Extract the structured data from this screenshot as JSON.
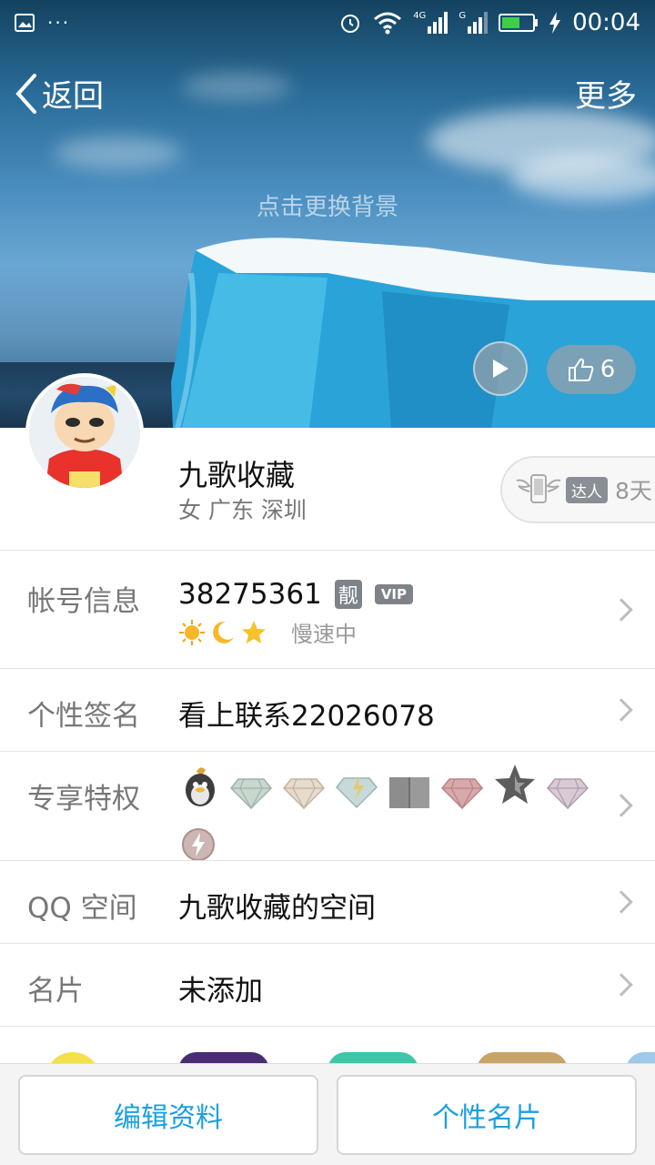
{
  "status_bar": {
    "time": "00:04",
    "network_1": "4G",
    "network_2": "G"
  },
  "nav": {
    "back_label": "返回",
    "more_label": "更多"
  },
  "hero": {
    "change_background": "点击更换背景",
    "like_count": "6"
  },
  "profile": {
    "nickname": "九歌收藏",
    "location": "女 广东 深圳",
    "talent_badge": "达人",
    "talent_days": "8天"
  },
  "rows": {
    "account": {
      "label": "帐号信息",
      "qq_number": "38275361",
      "liang_badge": "靓",
      "vip_badge": "VIP",
      "speed_status": "慢速中"
    },
    "signature": {
      "label": "个性签名",
      "value": "看上联系22026078"
    },
    "privileges": {
      "label": "专享特权"
    },
    "qzone": {
      "label": "QQ 空间",
      "value": "九歌收藏的空间"
    },
    "card": {
      "label": "名片",
      "value": "未添加"
    }
  },
  "bottom_bar": {
    "edit_profile": "编辑资料",
    "personal_card": "个性名片"
  },
  "colors": {
    "accent": "#1aa0e0",
    "label_gray": "#777777",
    "badge_gray": "#7d8389"
  }
}
